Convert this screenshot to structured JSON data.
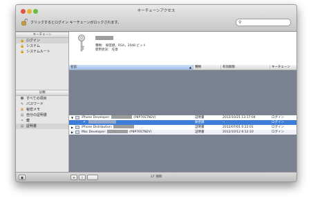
{
  "window": {
    "title": "キーチェーンアクセス"
  },
  "toolbar": {
    "lock_text": "クリックするとログイン キーチェーンがロックされます。",
    "search_placeholder": ""
  },
  "sidebar": {
    "keychains_header": "キーチェーン",
    "keychains": [
      {
        "label": "ログイン",
        "icon": "lock-open-icon",
        "selected": true
      },
      {
        "label": "システム",
        "icon": "lock-icon",
        "selected": false
      },
      {
        "label": "システムルート",
        "icon": "lock-icon",
        "selected": false
      }
    ],
    "category_header": "分類",
    "categories": [
      {
        "label": "すべての項目",
        "icon": "people-icon",
        "selected": false
      },
      {
        "label": "パスワード",
        "icon": "pencil-icon",
        "selected": false
      },
      {
        "label": "秘密メモ",
        "icon": "note-icon",
        "selected": false
      },
      {
        "label": "自分の証明書",
        "icon": "certificate-icon",
        "selected": false
      },
      {
        "label": "鍵",
        "icon": "key-icon",
        "selected": false
      },
      {
        "label": "証明書",
        "icon": "certificate-icon",
        "selected": true
      }
    ]
  },
  "info": {
    "line1": "種類： 秘密鍵，RSA，2048 ビット",
    "line2": "使用状況： 任意"
  },
  "table": {
    "columns": [
      "名前",
      "種類",
      "有効期限",
      "キーチェーン"
    ],
    "rows": [
      {
        "name_prefix": "iPhone Developer:",
        "name_suffix": "(P8P76STN2V)",
        "kind": "証明書",
        "expires": "2012/10/21 13:17:04",
        "keychain": "ログイン",
        "expanded": true,
        "selected": false,
        "child": false
      },
      {
        "name_prefix": "",
        "name_suffix": "",
        "kind": "秘密鍵",
        "expires": "--",
        "keychain": "ログイン",
        "expanded": false,
        "selected": true,
        "child": true
      },
      {
        "name_prefix": "iPhone Distribution:",
        "name_suffix": "",
        "kind": "証明書",
        "expires": "2012/07/01 0:22:01",
        "keychain": "ログイン",
        "expanded": false,
        "selected": false,
        "child": false
      },
      {
        "name_prefix": "Mac Developer:",
        "name_suffix": "(P8P76STN2V)",
        "kind": "証明書",
        "expires": "2012/10/12 6:12:10",
        "keychain": "ログイン",
        "expanded": false,
        "selected": false,
        "child": false
      }
    ]
  },
  "status": {
    "count": "17 項目",
    "add_label": "+",
    "info_label": "i"
  }
}
